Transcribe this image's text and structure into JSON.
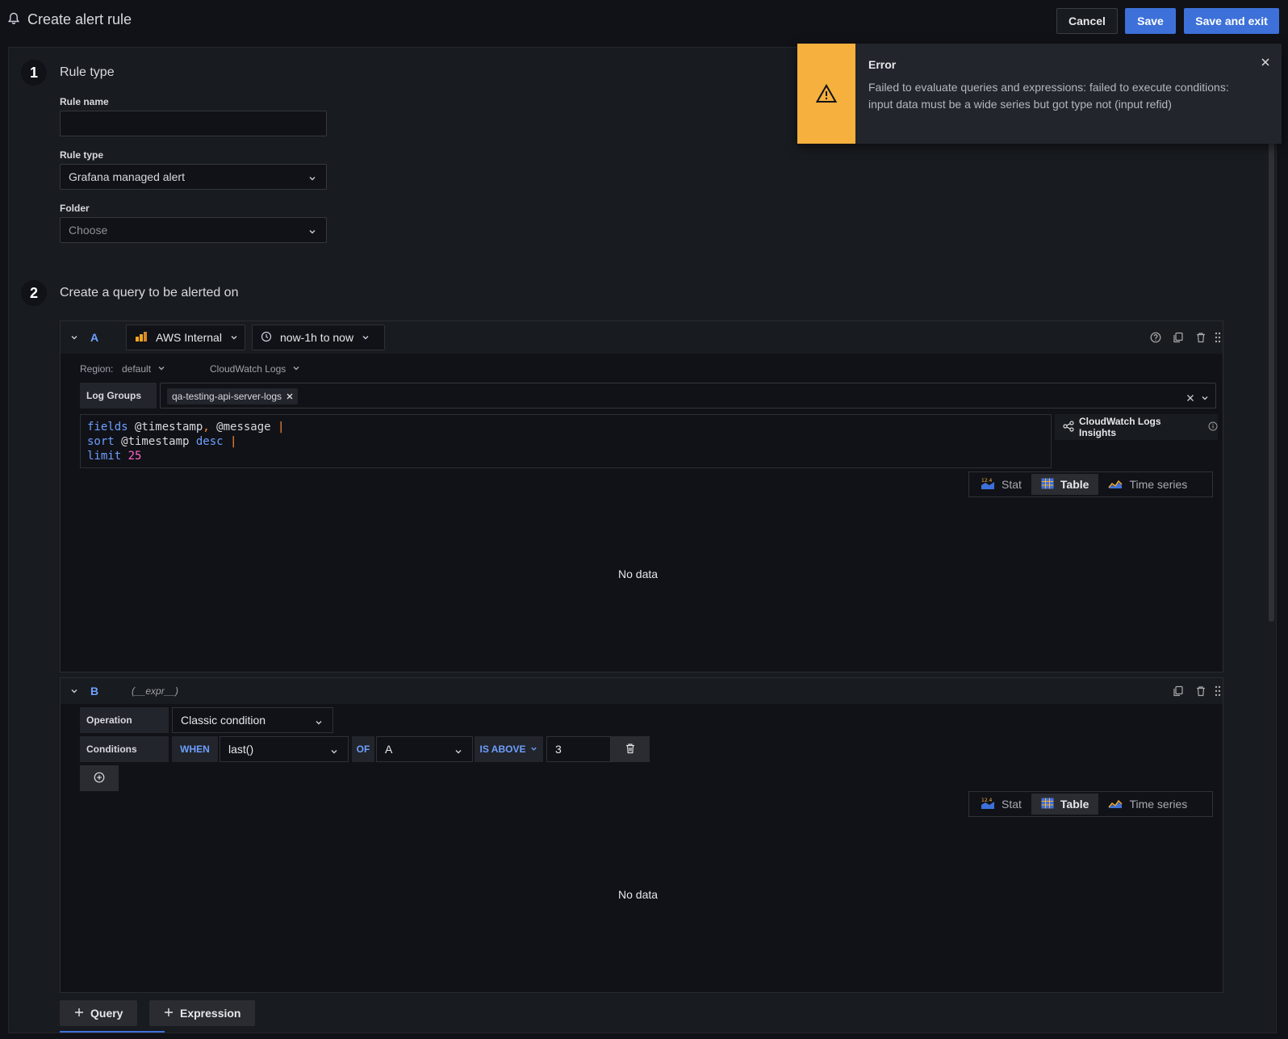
{
  "header": {
    "title": "Create alert rule",
    "cancel_label": "Cancel",
    "save_label": "Save",
    "save_exit_label": "Save and exit"
  },
  "step1": {
    "number": "1",
    "title": "Rule type",
    "rule_name_label": "Rule name",
    "rule_name_value": "",
    "rule_type_label": "Rule type",
    "rule_type_value": "Grafana managed alert",
    "folder_label": "Folder",
    "folder_placeholder": "Choose"
  },
  "step2": {
    "number": "2",
    "title": "Create a query to be alerted on"
  },
  "queryA": {
    "refid": "A",
    "datasource": "AWS Internal",
    "time_range": "now-1h to now",
    "region_label": "Region:",
    "region_value": "default",
    "service": "CloudWatch Logs",
    "log_groups_label": "Log Groups",
    "log_group_tag": "qa-testing-api-server-logs",
    "code": {
      "line1_kw": "fields",
      "line1_rest": " @timestamp",
      "line1_comma": ",",
      "line1_rest2": " @message ",
      "pipe": "|",
      "line2_kw": "sort",
      "line2_rest": " @timestamp ",
      "line2_kw2": "desc",
      "line3_kw": "limit",
      "line3_num": "25"
    },
    "insights_label": "CloudWatch Logs Insights",
    "viz_options": [
      "Stat",
      "Table",
      "Time series"
    ],
    "viz_selected": "Table",
    "no_data": "No data"
  },
  "queryB": {
    "refid": "B",
    "expr_label": "(__expr__)",
    "operation_label": "Operation",
    "operation_value": "Classic condition",
    "conditions_label": "Conditions",
    "when_label": "WHEN",
    "reducer_value": "last()",
    "of_label": "OF",
    "query_value": "A",
    "evaluator_label": "IS ABOVE",
    "threshold_value": "3",
    "viz_options": [
      "Stat",
      "Table",
      "Time series"
    ],
    "viz_selected": "Table",
    "no_data": "No data"
  },
  "footer": {
    "add_query_label": "Query",
    "add_expression_label": "Expression"
  },
  "toast": {
    "title": "Error",
    "message": "Failed to evaluate queries and expressions: failed to execute conditions: input data must be a wide series but got type not (input refid)"
  },
  "icons": {
    "stat_text": "12.4"
  },
  "colors": {
    "primary": "#3d71d9",
    "warning": "#f5b03e",
    "refid": "#6e9fff"
  }
}
